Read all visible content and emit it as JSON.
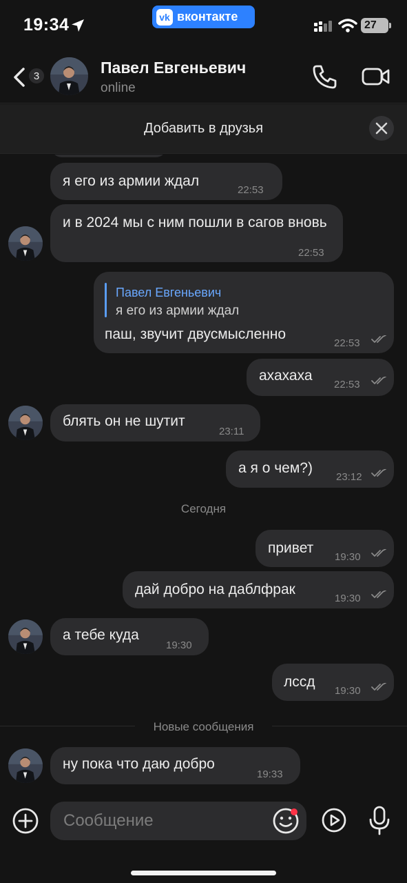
{
  "status_bar": {
    "time": "19:34",
    "app_badge": "вконтакте",
    "battery": "27"
  },
  "header": {
    "back_count": "3",
    "contact_name": "Павел Евгеньевич",
    "contact_status": "online"
  },
  "friend_bar": {
    "label": "Добавить в друзья"
  },
  "messages": [
    {
      "from": "them",
      "text": "я его из армии ждал",
      "time": "22:53"
    },
    {
      "from": "them",
      "text": "и в 2024 мы с ним пошли в сагов вновь",
      "time": "22:53"
    },
    {
      "from": "me",
      "reply_to_name": "Павел Евгеньевич",
      "reply_to_text": "я его из армии ждал",
      "text": "паш, звучит двусмысленно",
      "time": "22:53"
    },
    {
      "from": "me",
      "text": "ахахаха",
      "time": "22:53"
    },
    {
      "from": "them",
      "text": "блять он не шутит",
      "time": "23:11"
    },
    {
      "from": "me",
      "text": "а я о чем?)",
      "time": "23:12"
    },
    {
      "from": "me",
      "text": "привет",
      "time": "19:30"
    },
    {
      "from": "me",
      "text": "дай добро на даблфрак",
      "time": "19:30"
    },
    {
      "from": "them",
      "text": "а тебе куда",
      "time": "19:30"
    },
    {
      "from": "me",
      "text": "лссд",
      "time": "19:30"
    },
    {
      "from": "them",
      "text": "ну пока что даю добро",
      "time": "19:33"
    }
  ],
  "dividers": {
    "today": "Сегодня",
    "new_messages": "Новые сообщения"
  },
  "input": {
    "placeholder": "Сообщение"
  },
  "colors": {
    "background": "#141414",
    "bubble": "#2c2c2e",
    "accent": "#2d81ff",
    "reply_name": "#6aa8ff",
    "notification_dot": "#ff3347"
  },
  "icons": [
    "location-arrow-icon",
    "vk-logo-icon",
    "signal-icon",
    "wifi-icon",
    "battery-icon",
    "back-chevron-icon",
    "phone-icon",
    "video-camera-icon",
    "close-icon",
    "double-check-icon",
    "plus-icon",
    "emoji-icon",
    "video-message-icon",
    "microphone-icon"
  ]
}
